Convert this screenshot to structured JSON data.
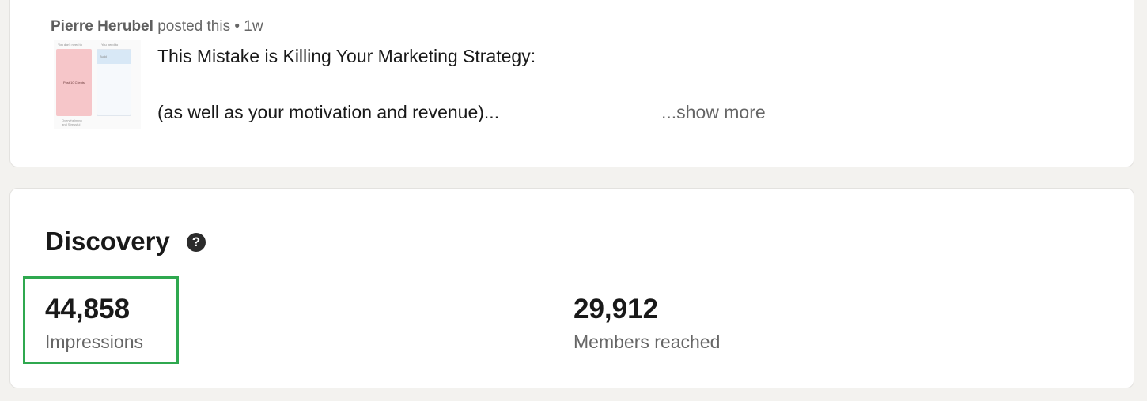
{
  "post": {
    "author": "Pierre Herubel",
    "meta_suffix": "posted this • 1w",
    "line1": "This Mistake is Killing Your Marketing Strategy:",
    "line2": "(as well as your motivation and revenue)...",
    "show_more": "...show more",
    "thumbnail": {
      "left_caption": "You don't need to",
      "right_caption": "You need to",
      "left_text": "Post 10 Clients",
      "right_text": "Build",
      "footer_line1": "Overwhelming",
      "footer_line2": "and Stressful"
    }
  },
  "discovery": {
    "title": "Discovery",
    "help_glyph": "?",
    "impressions_value": "44,858",
    "impressions_label": "Impressions",
    "reached_value": "29,912",
    "reached_label": "Members reached"
  },
  "colors": {
    "highlight": "#2fa84f",
    "background": "#f3f2ef"
  },
  "icons": [
    "help-icon"
  ]
}
